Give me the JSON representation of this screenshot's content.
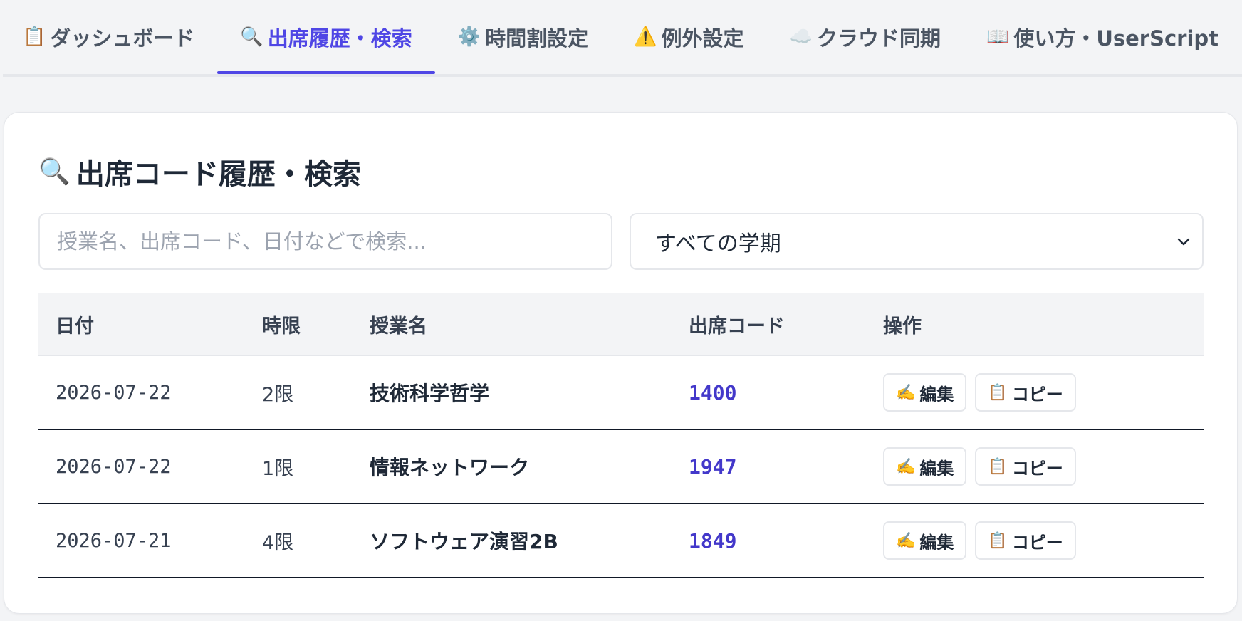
{
  "tabs": [
    {
      "icon": "📋",
      "icon_name": "clipboard-icon",
      "label": "ダッシュボード",
      "active": false
    },
    {
      "icon": "🔍",
      "icon_name": "magnifier-icon",
      "label": "出席履歴・検索",
      "active": true
    },
    {
      "icon": "⚙️",
      "icon_name": "gear-icon",
      "label": "時間割設定",
      "active": false
    },
    {
      "icon": "⚠️",
      "icon_name": "warning-icon",
      "label": "例外設定",
      "active": false
    },
    {
      "icon": "☁️",
      "icon_name": "cloud-icon",
      "label": "クラウド同期",
      "active": false
    },
    {
      "icon": "📖",
      "icon_name": "book-icon",
      "label": "使い方・UserScript",
      "active": false
    }
  ],
  "card": {
    "title_icon": "🔍",
    "title": "出席コード履歴・検索"
  },
  "search": {
    "placeholder": "授業名、出席コード、日付などで検索...",
    "value": ""
  },
  "term_select": {
    "selected": "すべての学期"
  },
  "table": {
    "headers": {
      "date": "日付",
      "period": "時限",
      "class": "授業名",
      "code": "出席コード",
      "ops": "操作"
    },
    "rows": [
      {
        "date": "2026-07-22",
        "period": "2限",
        "class": "技術科学哲学",
        "code": "1400"
      },
      {
        "date": "2026-07-22",
        "period": "1限",
        "class": "情報ネットワーク",
        "code": "1947"
      },
      {
        "date": "2026-07-21",
        "period": "4限",
        "class": "ソフトウェア演習2B",
        "code": "1849"
      }
    ],
    "edit_icon": "✍️",
    "edit_label": "編集",
    "copy_icon": "📋",
    "copy_label": "コピー"
  },
  "colors": {
    "accent": "#4f46e5",
    "code": "#4338ca",
    "background": "#f3f4f6"
  }
}
